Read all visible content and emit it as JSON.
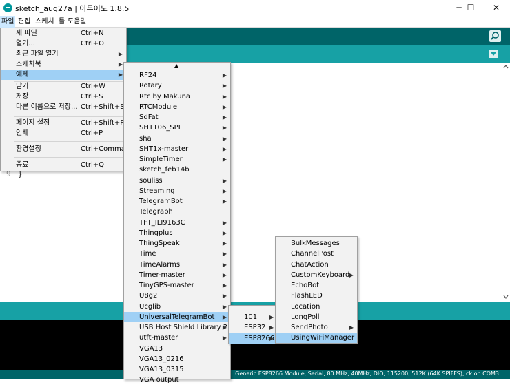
{
  "window": {
    "title": "sketch_aug27a | 아두이노 1.8.5",
    "controls": [
      "─",
      "☐",
      "✕"
    ]
  },
  "menubar": [
    "파일",
    "편집",
    "스케치",
    "툴",
    "도움말"
  ],
  "editor": {
    "line_number": "9",
    "code": "}"
  },
  "footer": {
    "board_status": "Generic ESP8266 Module, Serial, 80 MHz, 40MHz, DIO, 115200, 512K (64K SPIFFS), ck on COM3"
  },
  "file_menu": {
    "items": [
      {
        "label": "새 파일",
        "shortcut": "Ctrl+N"
      },
      {
        "label": "열기...",
        "shortcut": "Ctrl+O"
      },
      {
        "label": "최근 파일 열기",
        "shortcut": "",
        "submenu": true
      },
      {
        "label": "스케치북",
        "shortcut": "",
        "submenu": true
      },
      {
        "label": "예제",
        "shortcut": "",
        "submenu": true,
        "highlighted": true
      },
      {
        "label": "닫기",
        "shortcut": "Ctrl+W"
      },
      {
        "label": "저장",
        "shortcut": "Ctrl+S"
      },
      {
        "label": "다른 이름으로 저장...",
        "shortcut": "Ctrl+Shift+S"
      },
      {
        "label": "페이지 설정",
        "shortcut": "Ctrl+Shift+P"
      },
      {
        "label": "인쇄",
        "shortcut": "Ctrl+P"
      },
      {
        "label": "환경설정",
        "shortcut": "Ctrl+Comma"
      },
      {
        "label": "종료",
        "shortcut": "Ctrl+Q"
      }
    ]
  },
  "examples_menu": {
    "scroll_up_glyph": "▲",
    "items": [
      {
        "label": "RF24",
        "submenu": true
      },
      {
        "label": "Rotary",
        "submenu": true
      },
      {
        "label": "Rtc by Makuna",
        "submenu": true
      },
      {
        "label": "RTCModule",
        "submenu": true
      },
      {
        "label": "SdFat",
        "submenu": true
      },
      {
        "label": "SH1106_SPI",
        "submenu": true
      },
      {
        "label": "sha",
        "submenu": true
      },
      {
        "label": "SHT1x-master",
        "submenu": true
      },
      {
        "label": "SimpleTimer",
        "submenu": true
      },
      {
        "label": "sketch_feb14b",
        "submenu": false
      },
      {
        "label": "souliss",
        "submenu": true
      },
      {
        "label": "Streaming",
        "submenu": true
      },
      {
        "label": "TelegramBot",
        "submenu": true
      },
      {
        "label": "Telegraph",
        "submenu": false
      },
      {
        "label": "TFT_ILI9163C",
        "submenu": true
      },
      {
        "label": "Thingplus",
        "submenu": true
      },
      {
        "label": "ThingSpeak",
        "submenu": true
      },
      {
        "label": "Time",
        "submenu": true
      },
      {
        "label": "TimeAlarms",
        "submenu": true
      },
      {
        "label": "Timer-master",
        "submenu": true
      },
      {
        "label": "TinyGPS-master",
        "submenu": true
      },
      {
        "label": "U8g2",
        "submenu": true
      },
      {
        "label": "Ucglib",
        "submenu": true
      },
      {
        "label": "UniversalTelegramBot",
        "submenu": true,
        "highlighted": true
      },
      {
        "label": "USB Host Shield Library 2.0",
        "submenu": true
      },
      {
        "label": "utft-master",
        "submenu": true
      },
      {
        "label": "VGA13",
        "submenu": false
      },
      {
        "label": "VGA13_0216",
        "submenu": false
      },
      {
        "label": "VGA13_0315",
        "submenu": false
      },
      {
        "label": "VGA output",
        "submenu": false
      }
    ]
  },
  "utb_menu": {
    "items": [
      {
        "label": "101",
        "submenu": true
      },
      {
        "label": "ESP32",
        "submenu": true
      },
      {
        "label": "ESP8266",
        "submenu": true,
        "highlighted": true
      }
    ]
  },
  "esp8266_menu": {
    "items": [
      {
        "label": "BulkMessages",
        "submenu": false
      },
      {
        "label": "ChannelPost",
        "submenu": false
      },
      {
        "label": "ChatAction",
        "submenu": false
      },
      {
        "label": "CustomKeyboard",
        "submenu": true
      },
      {
        "label": "EchoBot",
        "submenu": false
      },
      {
        "label": "FlashLED",
        "submenu": false
      },
      {
        "label": "Location",
        "submenu": false
      },
      {
        "label": "LongPoll",
        "submenu": false
      },
      {
        "label": "SendPhoto",
        "submenu": true
      },
      {
        "label": "UsingWiFiManager",
        "submenu": false,
        "highlighted": true
      }
    ]
  },
  "colors": {
    "toolbar": "#006468",
    "tabstrip": "#17a1a5",
    "highlight": "#9fd0f5",
    "menubar_active": "#cce8ff"
  }
}
